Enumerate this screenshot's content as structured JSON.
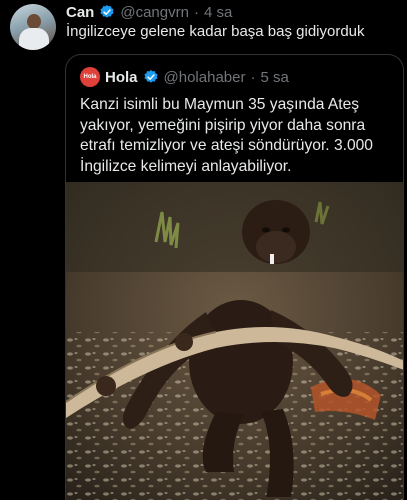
{
  "tweet": {
    "author_name": "Can",
    "author_handle": "@cangvrn",
    "separator": "·",
    "time": "4 sa",
    "text": "İngilizceye gelene kadar başa baş gidiyorduk"
  },
  "quote": {
    "logo_text": "Hola",
    "author_name": "Hola",
    "author_handle": "@holahaber",
    "separator": "·",
    "time": "5 sa",
    "text": "Kanzi isimli bu Maymun 35 yaşında Ateş yakıyor, yemeğini pişirip yiyor daha sonra etrafı temizliyor ve ateşi söndürüyor. 3.000 İngilizce kelimeyi anlayabiliyor."
  },
  "colors": {
    "background": "#000000",
    "text_primary": "#e7e9ea",
    "text_secondary": "#71767b",
    "verified": "#1d9bf0",
    "border": "#2f3336",
    "hola_brand": "#e0403a"
  },
  "icons": [
    "verified-badge-icon",
    "hola-logo"
  ]
}
